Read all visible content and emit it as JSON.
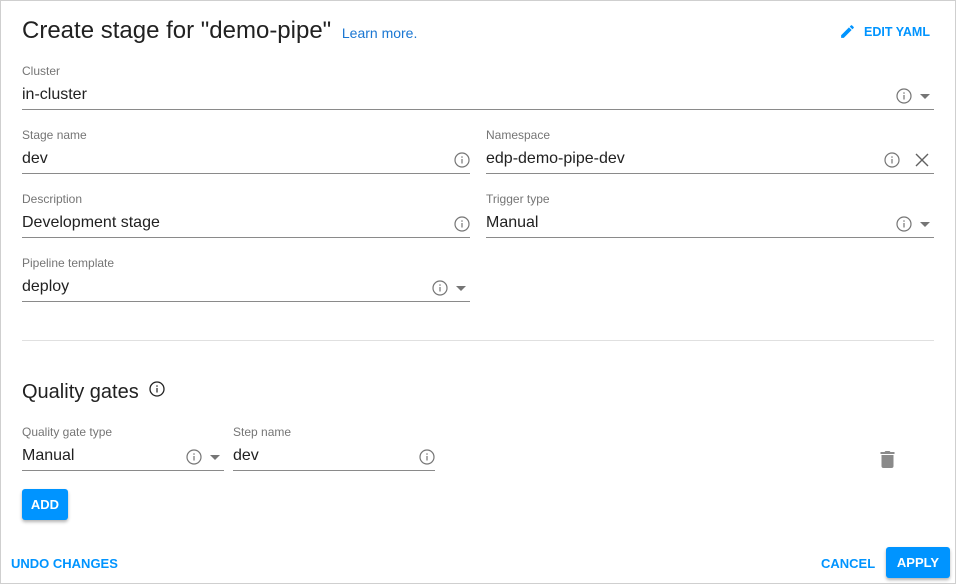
{
  "header": {
    "title": "Create stage for \"demo-pipe\"",
    "learn_more": "Learn more.",
    "edit_yaml": "EDIT YAML"
  },
  "fields": {
    "cluster": {
      "label": "Cluster",
      "value": "in-cluster"
    },
    "stage_name": {
      "label": "Stage name",
      "value": "dev"
    },
    "namespace": {
      "label": "Namespace",
      "value": "edp-demo-pipe-dev"
    },
    "description": {
      "label": "Description",
      "value": "Development stage"
    },
    "trigger_type": {
      "label": "Trigger type",
      "value": "Manual"
    },
    "pipeline_template": {
      "label": "Pipeline template",
      "value": "deploy"
    }
  },
  "quality_gates": {
    "title": "Quality gates",
    "rows": [
      {
        "type_label": "Quality gate type",
        "type_value": "Manual",
        "step_label": "Step name",
        "step_value": "dev"
      }
    ],
    "add_label": "ADD"
  },
  "footer": {
    "undo": "UNDO CHANGES",
    "cancel": "CANCEL",
    "apply": "APPLY"
  },
  "colors": {
    "accent": "#0094ff",
    "link": "#1976d2"
  }
}
